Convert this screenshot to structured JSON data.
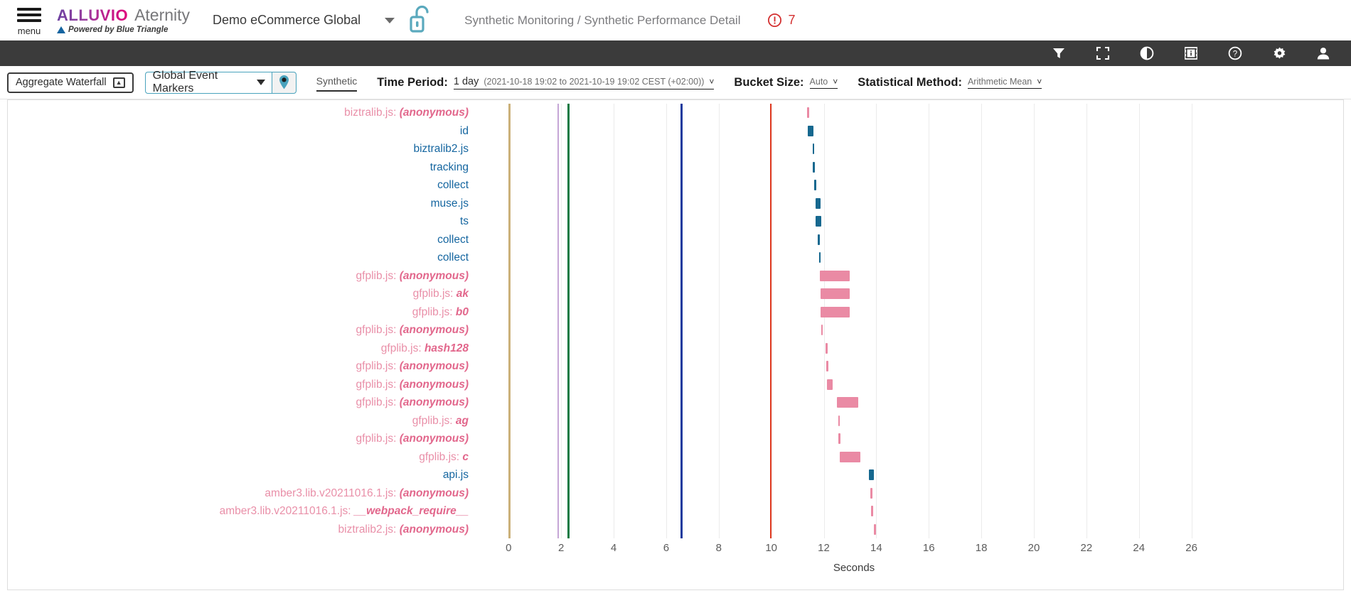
{
  "header": {
    "menu_label": "menu",
    "brand_primary": "ALLUVIO",
    "brand_secondary": "Aternity",
    "powered_by": "Powered by Blue Triangle",
    "account": "Demo eCommerce Global",
    "breadcrumb": "Synthetic Monitoring / Synthetic Performance Detail",
    "alert_count": "7",
    "alert_color": "#d32f2f"
  },
  "dark_toolbar": {
    "icons": [
      {
        "name": "filter-icon"
      },
      {
        "name": "fullscreen-icon"
      },
      {
        "name": "contrast-icon"
      },
      {
        "name": "film-info-icon"
      },
      {
        "name": "help-icon"
      },
      {
        "name": "settings-gear-icon"
      },
      {
        "name": "user-account-icon"
      }
    ]
  },
  "controls": {
    "aggregate_waterfall": "Aggregate Waterfall",
    "global_event_markers": "Global Event Markers",
    "synthetic_tab": "Synthetic",
    "time_period_label": "Time Period:",
    "time_period_value": "1 day",
    "time_period_detail": "(2021-10-18 19:02 to 2021-10-19 19:02 CEST (+02:00))",
    "bucket_size_label": "Bucket Size:",
    "bucket_size_value": "Auto",
    "statistical_method_label": "Statistical Method:",
    "statistical_method_value": "Arithmetic Mean"
  },
  "chart_data": {
    "type": "bar",
    "title": "",
    "xlabel": "Seconds",
    "ylabel": "",
    "xlim": [
      -1.2,
      27.5
    ],
    "ticks": [
      0,
      2,
      4,
      6,
      8,
      10,
      12,
      14,
      16,
      18,
      20,
      22,
      24,
      26
    ],
    "grid": true,
    "orientation": "horizontal-waterfall",
    "colors": {
      "resource_bar": "#16688f",
      "function_bar": "#ea8aa4",
      "resource_label": "#1566a0",
      "file_label": "#e98fa8",
      "function_label": "#e2678c",
      "gridline": "#ebebeb"
    },
    "event_markers": [
      {
        "label": "marker-0",
        "x": 0.0,
        "color": "#cbb17a"
      },
      {
        "label": "marker-1.9",
        "x": 1.85,
        "color": "#c5a6d6"
      },
      {
        "label": "marker-2.2",
        "x": 2.25,
        "color": "#107a43"
      },
      {
        "label": "marker-6.6",
        "x": 6.55,
        "color": "#1b3b9e"
      },
      {
        "label": "marker-10",
        "x": 9.95,
        "color": "#e03a21"
      }
    ],
    "rows": [
      {
        "file": "biztralib.js:",
        "fn": "(anonymous)",
        "kind": "function",
        "start": 11.35,
        "end": 11.45
      },
      {
        "file": "",
        "fn": "id",
        "kind": "resource",
        "start": 11.4,
        "end": 11.62
      },
      {
        "file": "",
        "fn": "biztralib2.js",
        "kind": "resource",
        "start": 11.57,
        "end": 11.63
      },
      {
        "file": "",
        "fn": "tracking",
        "kind": "resource",
        "start": 11.59,
        "end": 11.66
      },
      {
        "file": "",
        "fn": "collect",
        "kind": "resource",
        "start": 11.64,
        "end": 11.7
      },
      {
        "file": "",
        "fn": "muse.js",
        "kind": "resource",
        "start": 11.68,
        "end": 11.88
      },
      {
        "file": "",
        "fn": "ts",
        "kind": "resource",
        "start": 11.68,
        "end": 11.9
      },
      {
        "file": "",
        "fn": "collect",
        "kind": "resource",
        "start": 11.78,
        "end": 11.84
      },
      {
        "file": "",
        "fn": "collect",
        "kind": "resource",
        "start": 11.82,
        "end": 11.88
      },
      {
        "file": "gfplib.js:",
        "fn": "(anonymous)",
        "kind": "function",
        "start": 11.86,
        "end": 13.0
      },
      {
        "file": "gfplib.js:",
        "fn": "ak",
        "kind": "function",
        "start": 11.88,
        "end": 13.0
      },
      {
        "file": "gfplib.js:",
        "fn": "b0",
        "kind": "function",
        "start": 11.88,
        "end": 13.0
      },
      {
        "file": "gfplib.js:",
        "fn": "(anonymous)",
        "kind": "function",
        "start": 11.9,
        "end": 11.96
      },
      {
        "file": "gfplib.js:",
        "fn": "hash128",
        "kind": "function",
        "start": 12.08,
        "end": 12.13
      },
      {
        "file": "gfplib.js:",
        "fn": "(anonymous)",
        "kind": "function",
        "start": 12.1,
        "end": 12.16
      },
      {
        "file": "gfplib.js:",
        "fn": "(anonymous)",
        "kind": "function",
        "start": 12.12,
        "end": 12.35
      },
      {
        "file": "gfplib.js:",
        "fn": "(anonymous)",
        "kind": "function",
        "start": 12.5,
        "end": 13.3
      },
      {
        "file": "gfplib.js:",
        "fn": "ag",
        "kind": "function",
        "start": 12.55,
        "end": 12.62
      },
      {
        "file": "gfplib.js:",
        "fn": "(anonymous)",
        "kind": "function",
        "start": 12.56,
        "end": 12.63
      },
      {
        "file": "gfplib.js:",
        "fn": "c",
        "kind": "function",
        "start": 12.62,
        "end": 13.4
      },
      {
        "file": "",
        "fn": "api.js",
        "kind": "resource",
        "start": 13.72,
        "end": 13.92
      },
      {
        "file": "amber3.lib.v20211016.1.js:",
        "fn": "(anonymous)",
        "kind": "function",
        "start": 13.78,
        "end": 13.84
      },
      {
        "file": "amber3.lib.v20211016.1.js:",
        "fn": "__webpack_require__",
        "kind": "function",
        "start": 13.8,
        "end": 13.86
      },
      {
        "file": "biztralib2.js:",
        "fn": "(anonymous)",
        "kind": "function",
        "start": 13.92,
        "end": 13.98
      }
    ]
  }
}
